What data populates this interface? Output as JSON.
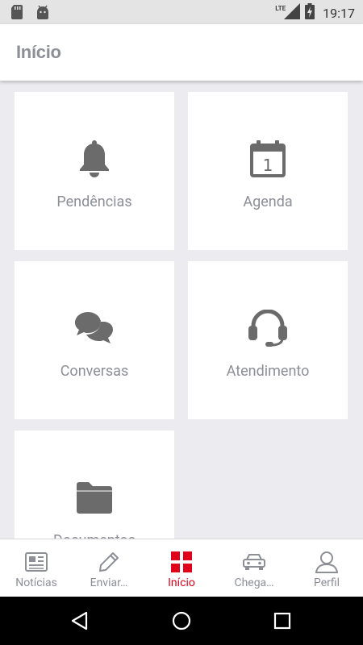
{
  "status_bar": {
    "time": "19:17",
    "network": "LTE",
    "icons": [
      "sd-card-icon",
      "android-icon",
      "signal-icon",
      "battery-charging-icon"
    ]
  },
  "app_bar": {
    "title": "Início"
  },
  "tiles": [
    {
      "label": "Pendências",
      "icon": "bell-icon"
    },
    {
      "label": "Agenda",
      "icon": "calendar-icon",
      "icon_text": "1"
    },
    {
      "label": "Conversas",
      "icon": "chat-bubbles-icon"
    },
    {
      "label": "Atendimento",
      "icon": "headset-icon"
    },
    {
      "label": "Documentos",
      "icon": "folder-icon"
    }
  ],
  "bottom_nav": {
    "items": [
      {
        "label": "Notícias",
        "icon": "newspaper-icon",
        "active": false
      },
      {
        "label": "Enviar…",
        "icon": "pencil-icon",
        "active": false
      },
      {
        "label": "Início",
        "icon": "grid-icon",
        "active": true
      },
      {
        "label": "Chega…",
        "icon": "car-icon",
        "active": false
      },
      {
        "label": "Perfil",
        "icon": "person-icon",
        "active": false
      }
    ]
  },
  "colors": {
    "accent": "#e0001b",
    "icon_gray": "#6b6b6b",
    "label_gray": "#8d8f97",
    "background": "#ebebf0"
  }
}
